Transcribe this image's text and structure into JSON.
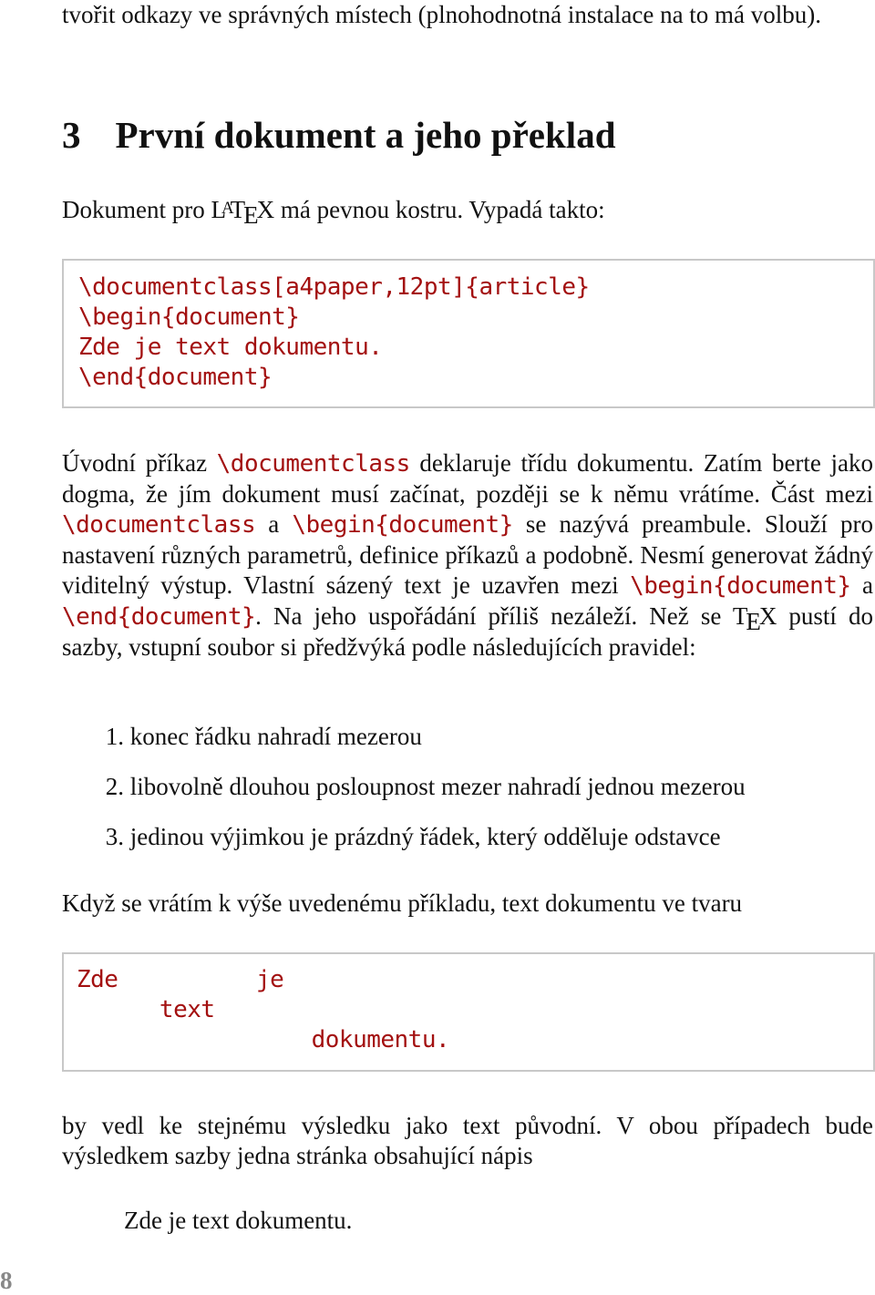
{
  "intro_tail": "tvořit odkazy ve správných místech (plnohodnotná instalace na to má volbu).",
  "section": {
    "number": "3",
    "title": "První dokument a jeho překlad"
  },
  "p1": {
    "before": "Dokument pro ",
    "logo": "LaTeX",
    "after": " má pevnou kostru. Vypadá takto:"
  },
  "code1": "\\documentclass[a4paper,12pt]{article}\n\\begin{document}\nZde je text dokumentu.\n\\end{document}",
  "p2": {
    "t1": "Úvodní příkaz ",
    "c1": "\\documentclass",
    "t2": " deklaruje třídu dokumentu. Zatím berte jako dogma, že jím dokument musí začínat, později se k němu vrátíme. Část mezi ",
    "c2": "\\documentclass",
    "t3": " a ",
    "c3": "\\begin{document}",
    "t4": " se nazý­vá preambule. Slouží pro nastavení různých parametrů, definice příka­zů a podobně. Nesmí generovat žádný viditelný výstup. Vlastní sázený text je uzavřen mezi ",
    "c4": "\\begin{document}",
    "t5": " a ",
    "c5": "\\end{document}",
    "t6": ". Na jeho uspořádání příliš nezáleží. Než se ",
    "logo": "TeX",
    "t7": " pustí do sazby, vstupní soubor si předžvýká podle následujících pravidel:"
  },
  "rules": [
    {
      "n": "1.",
      "text": "konec řádku nahradí mezerou"
    },
    {
      "n": "2.",
      "text": "libovolně dlouhou posloupnost mezer nahradí jednou mezerou"
    },
    {
      "n": "3.",
      "text": "jedinou výjimkou je prázdný řádek, který odděluje odstavce"
    }
  ],
  "p3": "Když se vrátím k výše uvedenému příkladu, text dokumentu ve tvaru",
  "code2": "Zde          je\n      text\n                 dokumentu.",
  "p4": "by vedl ke stejnému výsledku jako text původní. V obou případech bude výsledkem sazby jedna stránka obsahující nápis",
  "result": "Zde je text dokumentu.",
  "page_number": "8",
  "colors": {
    "code": "#a31010",
    "box_border": "#c8c8c8",
    "page_number": "#888888"
  }
}
